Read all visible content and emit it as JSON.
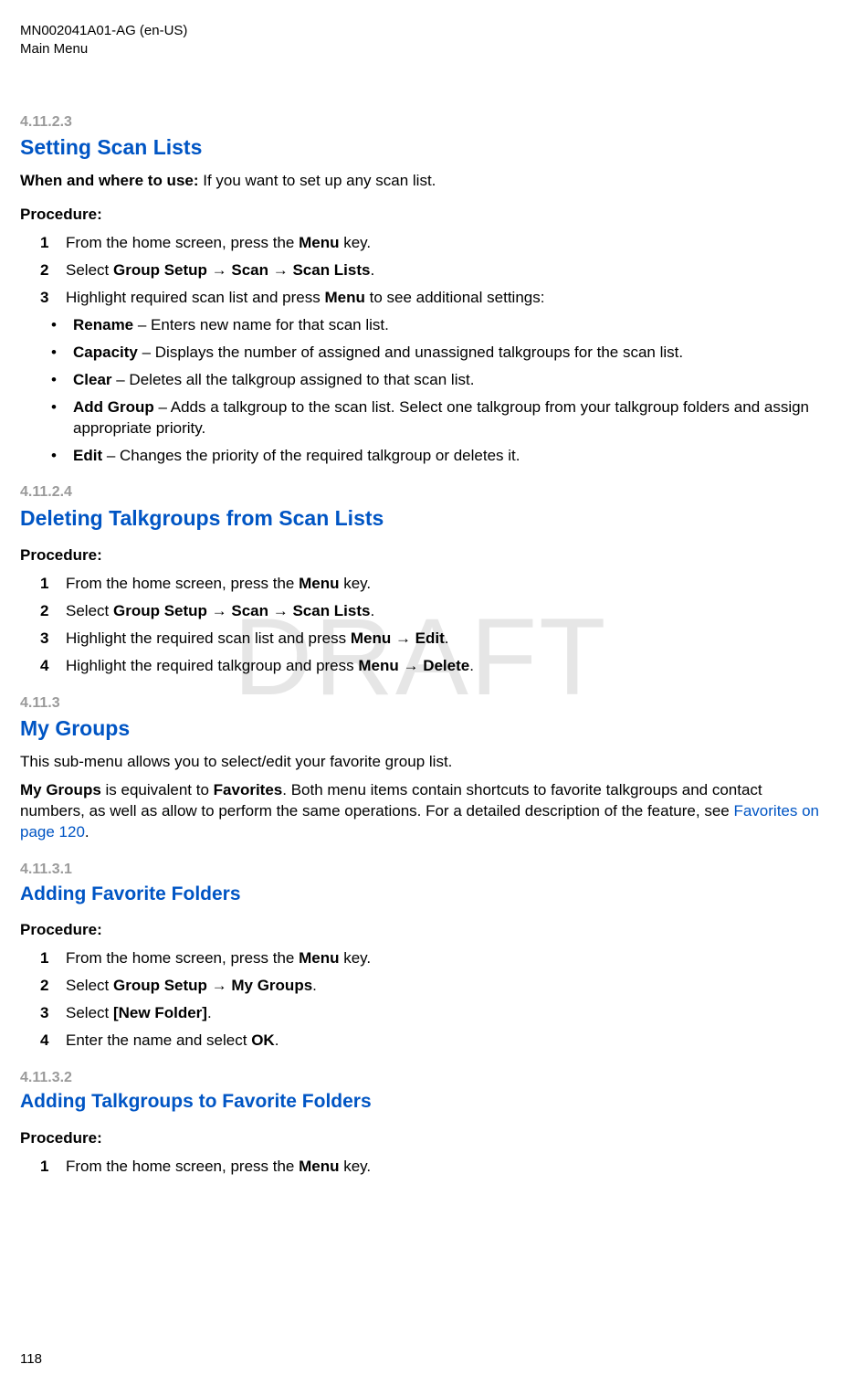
{
  "header": {
    "doc_id": "MN002041A01-AG (en-US)",
    "chapter": "Main Menu"
  },
  "watermark": "DRAFT",
  "s1": {
    "num": "4.11.2.3",
    "title": "Setting Scan Lists",
    "when_label": "When and where to use:",
    "when_text": " If you want to set up any scan list.",
    "proc_label": "Procedure:",
    "steps": [
      {
        "n": "1",
        "pre": "From the home screen, press the ",
        "b1": "Menu",
        "post": " key."
      },
      {
        "n": "2",
        "pre": "Select ",
        "b1": "Group Setup → Scan → Scan Lists",
        "post": "."
      },
      {
        "n": "3",
        "pre": "Highlight required scan list and press ",
        "b1": "Menu",
        "post": " to see additional settings:"
      }
    ],
    "bullets": [
      {
        "b": "Rename",
        "t": " – Enters new name for that scan list."
      },
      {
        "b": "Capacity",
        "t": " – Displays the number of assigned and unassigned talkgroups for the scan list."
      },
      {
        "b": "Clear",
        "t": " – Deletes all the talkgroup assigned to that scan list."
      },
      {
        "b": "Add Group",
        "t": " – Adds a talkgroup to the scan list. Select one talkgroup from your talkgroup folders and assign appropriate priority."
      },
      {
        "b": "Edit",
        "t": " – Changes the priority of the required talkgroup or deletes it."
      }
    ]
  },
  "s2": {
    "num": "4.11.2.4",
    "title": "Deleting Talkgroups from Scan Lists",
    "proc_label": "Procedure:",
    "steps": [
      {
        "n": "1",
        "pre": "From the home screen, press the ",
        "b1": "Menu",
        "post": " key."
      },
      {
        "n": "2",
        "pre": "Select ",
        "b1": "Group Setup → Scan → Scan Lists",
        "post": "."
      },
      {
        "n": "3",
        "pre": "Highlight the required scan list and press ",
        "b1": "Menu → Edit",
        "post": "."
      },
      {
        "n": "4",
        "pre": "Highlight the required talkgroup and press ",
        "b1": "Menu → Delete",
        "post": "."
      }
    ]
  },
  "s3": {
    "num": "4.11.3",
    "title": "My Groups",
    "p1": "This sub-menu allows you to select/edit your favorite group list.",
    "p2a_b": "My Groups",
    "p2a": " is equivalent to ",
    "p2b_b": "Favorites",
    "p2b": ". Both menu items contain shortcuts to favorite talkgroups and contact numbers, as well as allow to perform the same operations. For a detailed description of the feature, see ",
    "p2_link": "Favorites on page 120",
    "p2_end": "."
  },
  "s4": {
    "num": "4.11.3.1",
    "title": "Adding Favorite Folders",
    "proc_label": "Procedure:",
    "steps": [
      {
        "n": "1",
        "pre": "From the home screen, press the ",
        "b1": "Menu",
        "post": " key."
      },
      {
        "n": "2",
        "pre": "Select ",
        "b1": "Group Setup → My Groups",
        "post": "."
      },
      {
        "n": "3",
        "pre": "Select ",
        "b1": "[New Folder]",
        "post": "."
      },
      {
        "n": "4",
        "pre": "Enter the name and select ",
        "b1": "OK",
        "post": "."
      }
    ]
  },
  "s5": {
    "num": "4.11.3.2",
    "title": "Adding Talkgroups to Favorite Folders",
    "proc_label": "Procedure:",
    "steps": [
      {
        "n": "1",
        "pre": "From the home screen, press the ",
        "b1": "Menu",
        "post": " key."
      }
    ]
  },
  "page_number": "118"
}
